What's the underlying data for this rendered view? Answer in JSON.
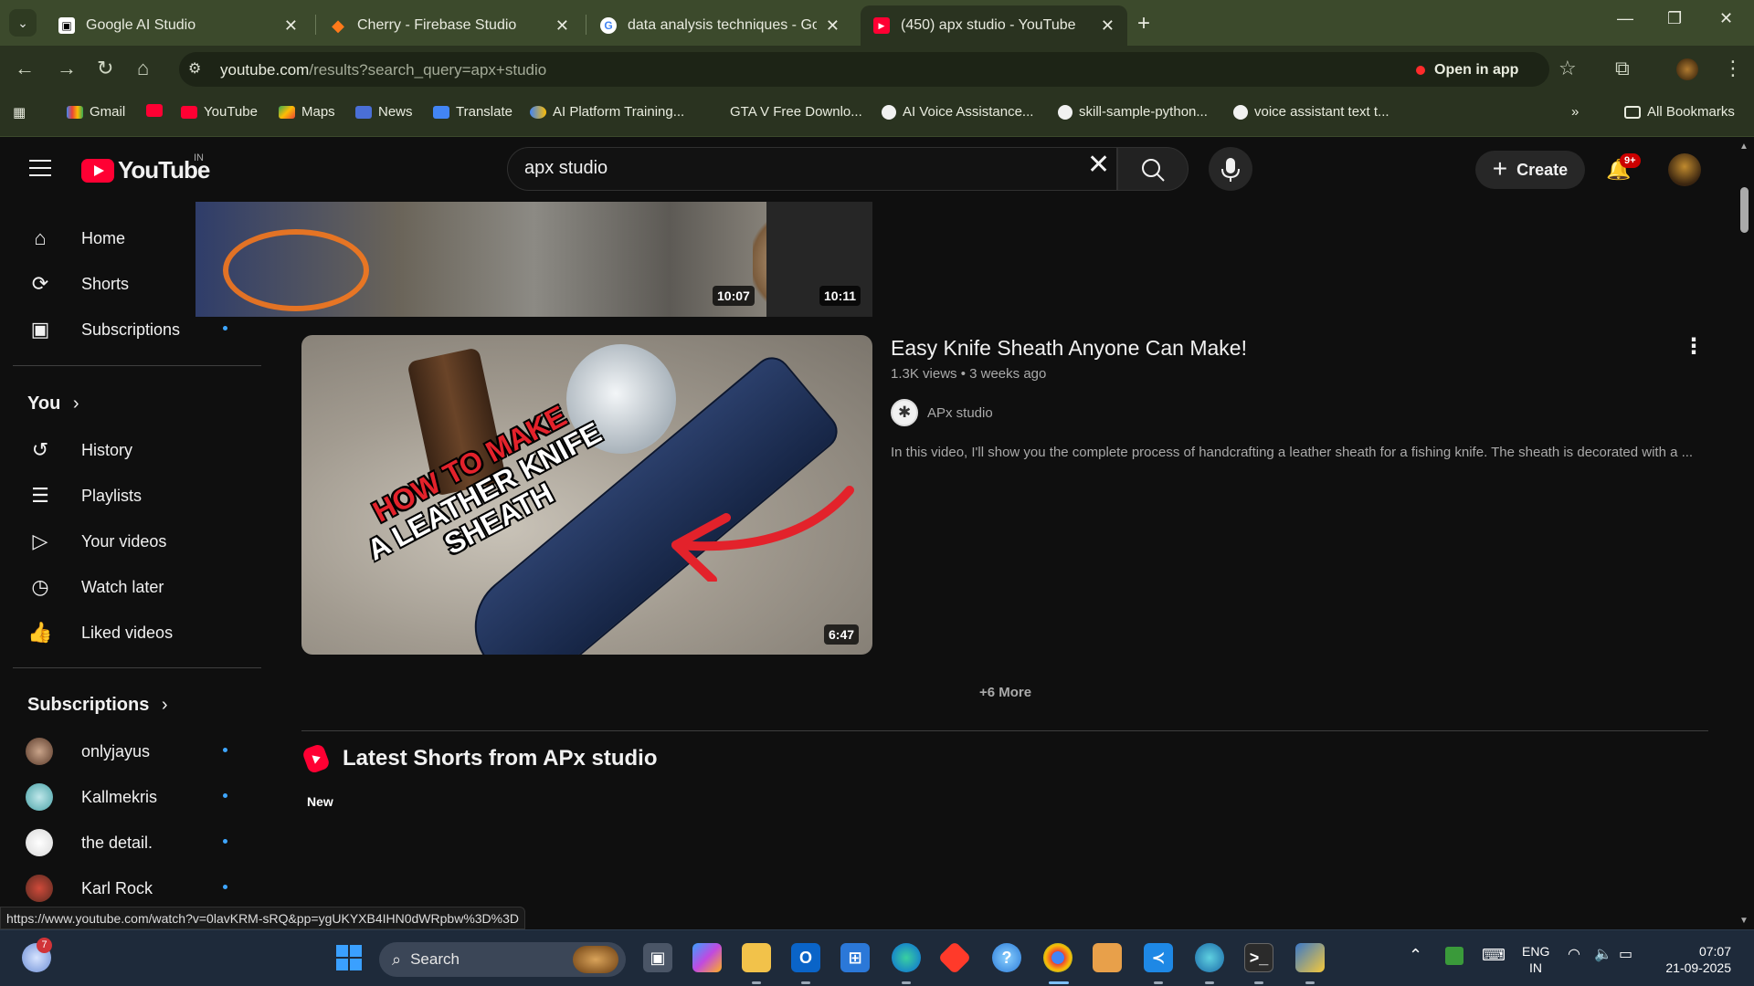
{
  "browser": {
    "tabs": [
      {
        "title": "Google AI Studio",
        "icon": "ai-studio-icon"
      },
      {
        "title": "Cherry - Firebase Studio",
        "icon": "firebase-icon"
      },
      {
        "title": "data analysis techniques - Goo",
        "icon": "google-icon"
      },
      {
        "title": "(450) apx studio - YouTube",
        "icon": "youtube-icon",
        "active": true
      }
    ],
    "url_host": "youtube.com",
    "url_path": "/results?search_query=apx+studio",
    "open_in_app": "Open in app",
    "bookmarks": [
      "Gmail",
      "YouTube",
      "Maps",
      "News",
      "Translate",
      "AI Platform Training...",
      "GTA V Free Downlo...",
      "AI Voice Assistance...",
      "skill-sample-python...",
      "voice assistant text t..."
    ],
    "all_bookmarks": "All Bookmarks",
    "status_url": "https://www.youtube.com/watch?v=0lavKRM-sRQ&pp=ygUKYXB4IHN0dWRpbw%3D%3D"
  },
  "youtube": {
    "logo_text": "YouTube",
    "country": "IN",
    "search_query": "apx studio",
    "create_label": "Create",
    "notif_badge": "9+",
    "sidebar": {
      "main": [
        "Home",
        "Shorts",
        "Subscriptions"
      ],
      "you_heading": "You",
      "you_items": [
        "History",
        "Playlists",
        "Your videos",
        "Watch later",
        "Liked videos"
      ],
      "subs_heading": "Subscriptions",
      "subs": [
        "onlyjayus",
        "Kallmekris",
        "the detail.",
        "Karl Rock"
      ]
    },
    "top_durations": [
      "10:07",
      "10:11"
    ],
    "video": {
      "title": "Easy Knife Sheath Anyone Can Make!",
      "meta": "1.3K views • 3 weeks ago",
      "channel": "APx studio",
      "description": "In this video, I'll show you the complete process of handcrafting a leather sheath for a fishing knife. The sheath is decorated with a ...",
      "duration": "6:47",
      "thumb_text_line1": "HOW TO MAKE",
      "thumb_text_line2": "A LEATHER KNIFE",
      "thumb_text_line3": "SHEATH"
    },
    "more_label": "+6 More",
    "shorts_heading": "Latest Shorts from APx studio",
    "new_label": "New"
  },
  "taskbar": {
    "weather_badge": "7",
    "search_label": "Search",
    "lang_top": "ENG",
    "lang_bottom": "IN",
    "time": "07:07",
    "date": "21-09-2025"
  },
  "colors": {
    "yt_red": "#ff0033",
    "bg": "#0f0f0f",
    "chrome": "#2a3320",
    "link_blue": "#3ea6ff"
  }
}
